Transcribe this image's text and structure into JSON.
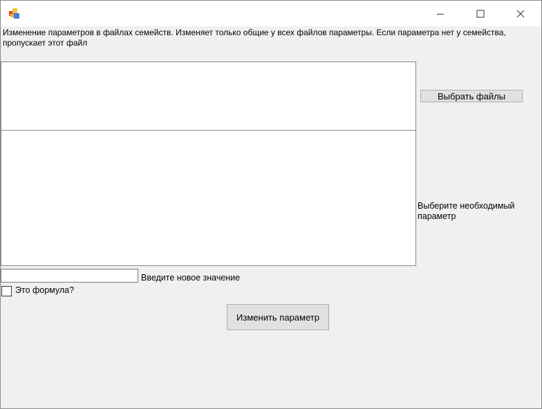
{
  "window": {
    "icon": "app-icon",
    "controls": [
      "minimize-icon",
      "maximize-icon",
      "close-icon"
    ]
  },
  "description": "Изменение параметров в файлах семейств. Изменяет только общие у всех файлов параметры. Если параметра нет у семейства, пропускает этот файл",
  "files": {
    "button_label": "Выбрать файлы",
    "items": []
  },
  "parameters": {
    "label": "Выберите необходимый параметр",
    "items": []
  },
  "new_value": {
    "value": "",
    "label": "Введите новое значение"
  },
  "formula": {
    "checked": false,
    "label": "Это формула?"
  },
  "change_button_label": "Изменить параметр"
}
